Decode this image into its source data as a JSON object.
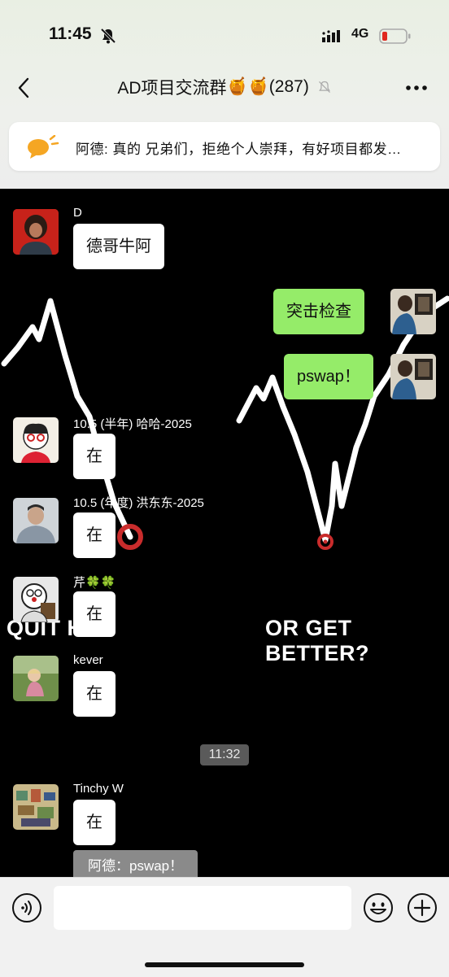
{
  "status_bar": {
    "time": "11:45",
    "network": "4G"
  },
  "header": {
    "title": "AD项目交流群",
    "title_emoji": "🍯🍯",
    "member_count": "(287)"
  },
  "pinned": {
    "text": "阿德: 真的 兄弟们，拒绝个人崇拜，有好项目都发…"
  },
  "video_overlay": {
    "left_text": "QUIT H",
    "right_text": "OR GET BETTER?"
  },
  "messages": [
    {
      "sender": "D",
      "text": "德哥牛阿"
    },
    {
      "sender": "",
      "text": "突击检查",
      "self": true
    },
    {
      "sender": "",
      "text": "pswap！",
      "self": true
    },
    {
      "sender": "10.5 (半年) 哈哈-2025",
      "text": "在"
    },
    {
      "sender": "10.5 (年度) 洪东东-2025",
      "text": "在"
    },
    {
      "sender": "芹🍀🍀",
      "text": "在"
    },
    {
      "sender": "kever",
      "text": "在"
    },
    {
      "sender": "Tinchy W",
      "text": "在"
    }
  ],
  "time_divider": "11:32",
  "quote": {
    "text": "阿德：pswap！"
  },
  "colors": {
    "self_bubble": "#95ec69",
    "accent_red": "#c92c2c"
  }
}
